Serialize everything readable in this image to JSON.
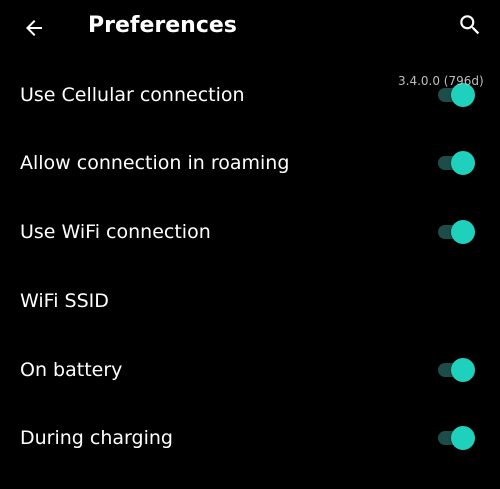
{
  "app_bar": {
    "back_icon": "arrow-back-icon",
    "title": "Preferences",
    "search_icon": "search-icon"
  },
  "version": "3.4.0.0 (796d)",
  "colors": {
    "background": "#000000",
    "text": "#ffffff",
    "accent": "#1fd1bd",
    "switch_track_on": "#1d4d48",
    "secondary_text": "#bdbdbd"
  },
  "preferences": [
    {
      "label": "Use Cellular connection",
      "has_switch": true,
      "checked": true
    },
    {
      "label": "Allow connection in roaming",
      "has_switch": true,
      "checked": true
    },
    {
      "label": "Use WiFi connection",
      "has_switch": true,
      "checked": true
    },
    {
      "label": "WiFi SSID",
      "has_switch": false
    },
    {
      "label": "On battery",
      "has_switch": true,
      "checked": true
    },
    {
      "label": "During charging",
      "has_switch": true,
      "checked": true
    }
  ]
}
